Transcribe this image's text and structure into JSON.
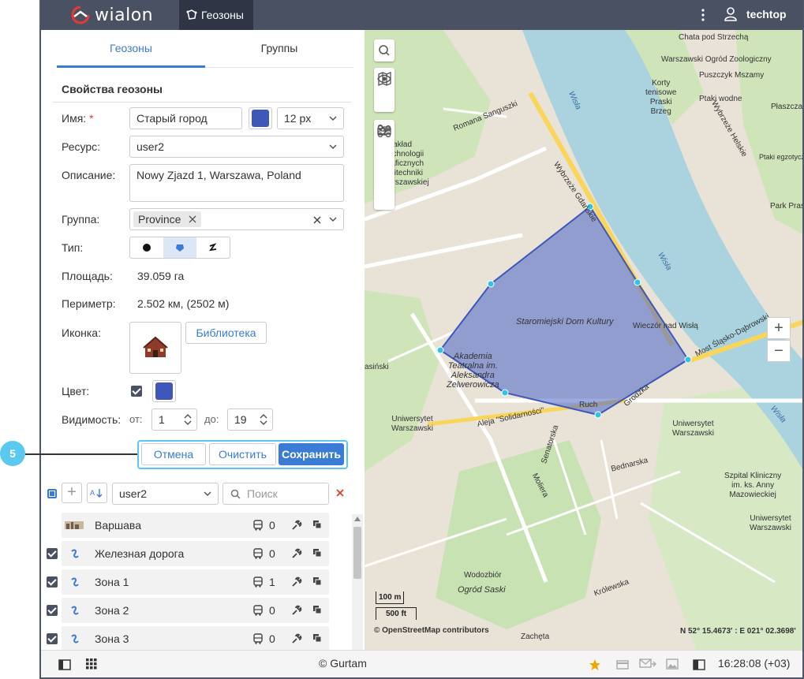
{
  "app": {
    "logo_text": "wialon",
    "module": "Геозоны",
    "user": "techtop"
  },
  "tabs": [
    "Геозоны",
    "Группы"
  ],
  "form": {
    "section_title": "Свойства геозоны",
    "name_label": "Имя:",
    "name_required": "*",
    "name_value": "Старый город",
    "font_size": "12 px",
    "resource_label": "Ресурс:",
    "resource_value": "user2",
    "description_label": "Описание:",
    "description_value": "Nowy Zjazd 1, Warszawa, Poland",
    "group_label": "Группа:",
    "group_chip": "Province",
    "type_label": "Тип:",
    "area_label": "Площадь:",
    "area_value": "39.059 га",
    "perimeter_label": "Периметр:",
    "perimeter_value": "2.502 км, (2502 м)",
    "icon_label": "Иконка:",
    "library_button": "Библиотека",
    "color_label": "Цвет:",
    "visibility_label": "Видимость:",
    "from_label": "от:",
    "from_value": "1",
    "to_label": "до:",
    "to_value": "19",
    "cancel": "Отмена",
    "clear": "Очистить",
    "save": "Сохранить",
    "callout_number": "5"
  },
  "list_toolbar": {
    "resource": "user2",
    "search_placeholder": "Поиск"
  },
  "geofences": [
    {
      "name": "Варшава",
      "count": "0",
      "checked": false
    },
    {
      "name": "Железная дорога",
      "count": "0",
      "checked": true
    },
    {
      "name": "Зона 1",
      "count": "1",
      "checked": true
    },
    {
      "name": "Зона 2",
      "count": "0",
      "checked": true
    },
    {
      "name": "Зона 3",
      "count": "0",
      "checked": true
    }
  ],
  "footer": {
    "copyright": "© Gurtam",
    "time": "16:28:08 (+03)"
  },
  "map": {
    "attribution": "© OpenStreetMap contributors",
    "coords": "N 52° 15.4673' : E 021° 02.3698'",
    "scale_m": "100 m",
    "scale_ft": "500 ft",
    "labels": {
      "chata": "Chata pod Strzechą",
      "ogrod": "Warszawski Ogród Zoologiczny",
      "puszczyk": "Puszczyk Mszamy",
      "korty": "Korty\ntenisowe\nPraski\nBrzeg",
      "ptaki_wodne": "Ptaki wodne",
      "plaszczaki": "Płaszczaki",
      "ptaki_egzot": "Ptaki egzotyczne",
      "park": "Park Prask",
      "wisla1": "Wisła",
      "wisla2": "Wisła",
      "wisla3": "Wisła",
      "staromiejski": "Staromiejski Dom Kultury",
      "wieczor": "Wieczór nad Wisłą",
      "most": "Most Śląsko-Dąbrowski",
      "akademia": "Akademia\nTeatralna im.\nAleksandra\nZelwerowicza",
      "solidarnosci": "Aleja \"Solidarności\"",
      "uniwersytet1": "Uniwersytet\nWarszawski",
      "uniwersytet2": "Uniwersytet\nWarszawski",
      "uniwersytet3": "Uniwersytet\nWarszawski",
      "szpital": "Szpital Kliniczny\nim. ks. Anny\nMazowieckiej",
      "wodozbior": "Wodozbiór",
      "ogrod_saski": "Ogród Saski",
      "zacheta": "Zachęta",
      "wybrzeze": "Wybrzeże Gdańskie",
      "romana": "Romana Sanguszki",
      "zaklad": "Zakład\nechnologii\nraficznych\nolitechniki\narszawskiej",
      "senatorska": "Senatorska",
      "moliera": "Moliera",
      "krolewska": "Królewska",
      "bednarska": "Bednarska",
      "ruch": "Ruch",
      "grodzka": "Grodzka",
      "wybrzeze_helskie": "Wybrzeże Helskie",
      "ksinski": "asiński"
    }
  }
}
